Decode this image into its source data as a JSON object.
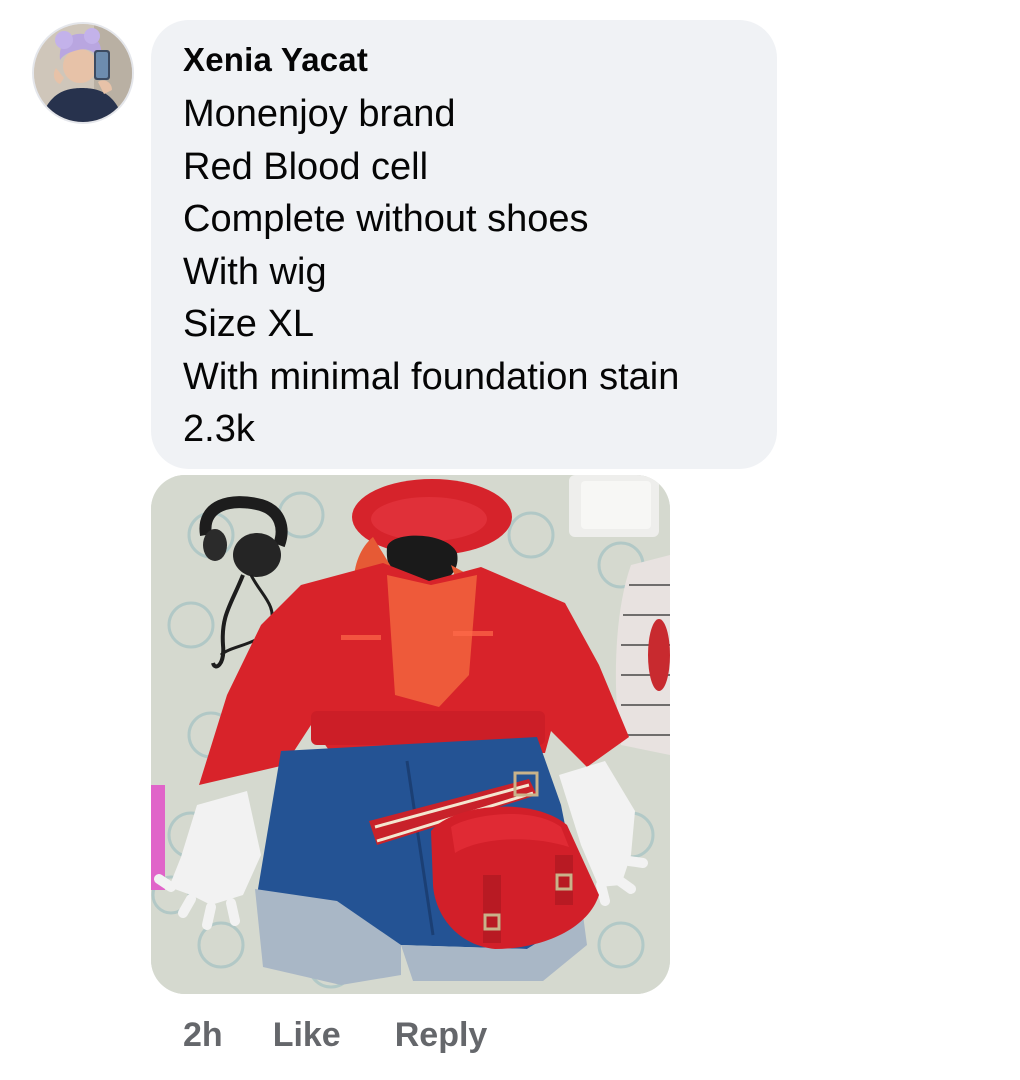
{
  "comment": {
    "author": "Xenia Yacat",
    "lines": [
      "Monenjoy brand",
      "Red Blood cell",
      "Complete without shoes",
      "With wig",
      "Size XL",
      "With minimal foundation stain",
      "2.3k"
    ],
    "time": "2h",
    "like_label": "Like",
    "reply_label": "Reply"
  },
  "colors": {
    "bubble_bg": "#f0f2f5",
    "meta_text": "#65676b",
    "costume_red": "#d8232a"
  }
}
